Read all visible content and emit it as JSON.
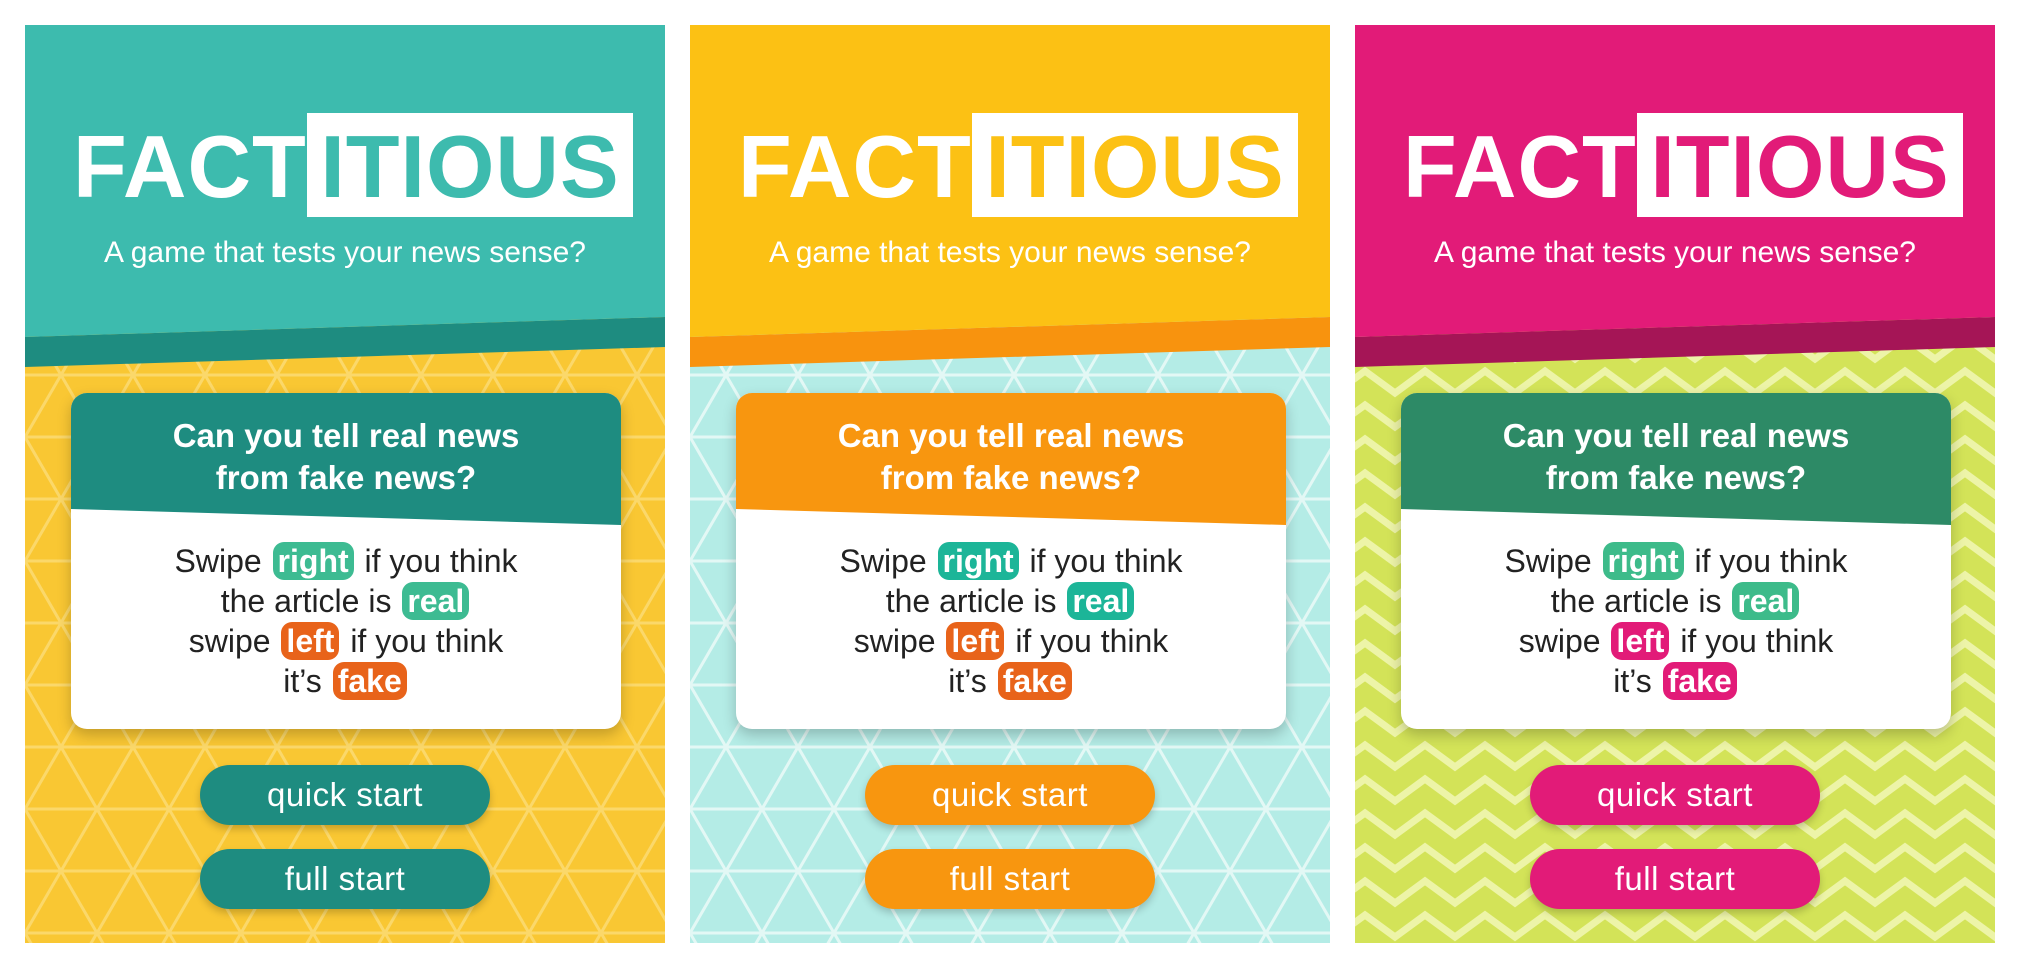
{
  "screens": [
    {
      "logo_part1": "FACT",
      "logo_part2": "ITIOUS",
      "tagline": "A game that tests your news sense?",
      "card_title": "Can you tell real news\nfrom fake news?",
      "line1": {
        "before": "Swipe",
        "chip": "right",
        "after": "if you think"
      },
      "line2": {
        "before": "the article is",
        "chip": "real"
      },
      "line3": {
        "before": "swipe",
        "chip": "left",
        "after": "if you think"
      },
      "line4": {
        "before": "it’s",
        "chip": "fake"
      },
      "quick_start": "quick start",
      "full_start": "full start",
      "colors": {
        "header": "#3dbbae",
        "header_shade": "#1e8c80",
        "card_head": "#1e8c80",
        "pattern_bg": "#f9c733",
        "pattern_line": "#fbd86a",
        "right_chip": "#3dbb92",
        "left_chip": "#e8631a",
        "button": "#1e8c80"
      },
      "pattern": "triangle-grid"
    },
    {
      "logo_part1": "FACT",
      "logo_part2": "ITIOUS",
      "tagline": "A game that tests your news sense?",
      "card_title": "Can you tell real news\nfrom fake news?",
      "line1": {
        "before": "Swipe",
        "chip": "right",
        "after": "if you think"
      },
      "line2": {
        "before": "the article is",
        "chip": "real"
      },
      "line3": {
        "before": "swipe",
        "chip": "left",
        "after": "if you think"
      },
      "line4": {
        "before": "it’s",
        "chip": "fake"
      },
      "quick_start": "quick start",
      "full_start": "full start",
      "colors": {
        "header": "#fcc114",
        "header_shade": "#f8930e",
        "card_head": "#f8960f",
        "pattern_bg": "#b4ece6",
        "pattern_line": "#e3f8f5",
        "right_chip": "#1cb598",
        "left_chip": "#e8631a",
        "button": "#f8960f"
      },
      "pattern": "triangle-grid"
    },
    {
      "logo_part1": "FACT",
      "logo_part2": "ITIOUS",
      "tagline": "A game that tests your news sense?",
      "card_title": "Can you tell real news\nfrom fake news?",
      "line1": {
        "before": "Swipe",
        "chip": "right",
        "after": "if you think"
      },
      "line2": {
        "before": "the article is",
        "chip": "real"
      },
      "line3": {
        "before": "swipe",
        "chip": "left",
        "after": "if you think"
      },
      "line4": {
        "before": "it’s",
        "chip": "fake"
      },
      "quick_start": "quick start",
      "full_start": "full start",
      "colors": {
        "header": "#e21b78",
        "header_shade": "#a51556",
        "card_head": "#2d8a66",
        "pattern_bg": "#d3e358",
        "pattern_line": "#edf4a8",
        "right_chip": "#3dbb8a",
        "left_chip": "#e21b78",
        "button": "#e21b78"
      },
      "pattern": "chevron"
    }
  ]
}
